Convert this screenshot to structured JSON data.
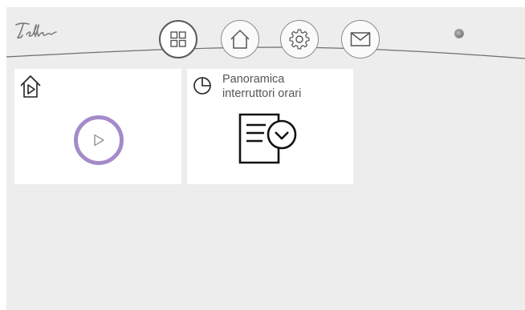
{
  "brand": {
    "logo_text": "Feller"
  },
  "nav": {
    "items": [
      {
        "id": "overview",
        "icon": "grid-icon",
        "active": true
      },
      {
        "id": "home",
        "icon": "house-icon",
        "active": false
      },
      {
        "id": "settings",
        "icon": "gear-icon",
        "active": false
      },
      {
        "id": "messages",
        "icon": "envelope-icon",
        "active": false
      }
    ]
  },
  "status": {
    "indicator": "status-dot"
  },
  "tiles": [
    {
      "id": "scene",
      "icon": "house-play-icon",
      "control_icon": "play-icon",
      "accent": "#a58bc9"
    },
    {
      "id": "timer-overview",
      "icon": "pie-clock-icon",
      "title_line1": "Panoramica",
      "title_line2": "interruttori orari",
      "illustration": "schedule-clock-icon"
    }
  ],
  "colors": {
    "background": "#ededed",
    "tile": "#ffffff",
    "text": "#555555"
  }
}
